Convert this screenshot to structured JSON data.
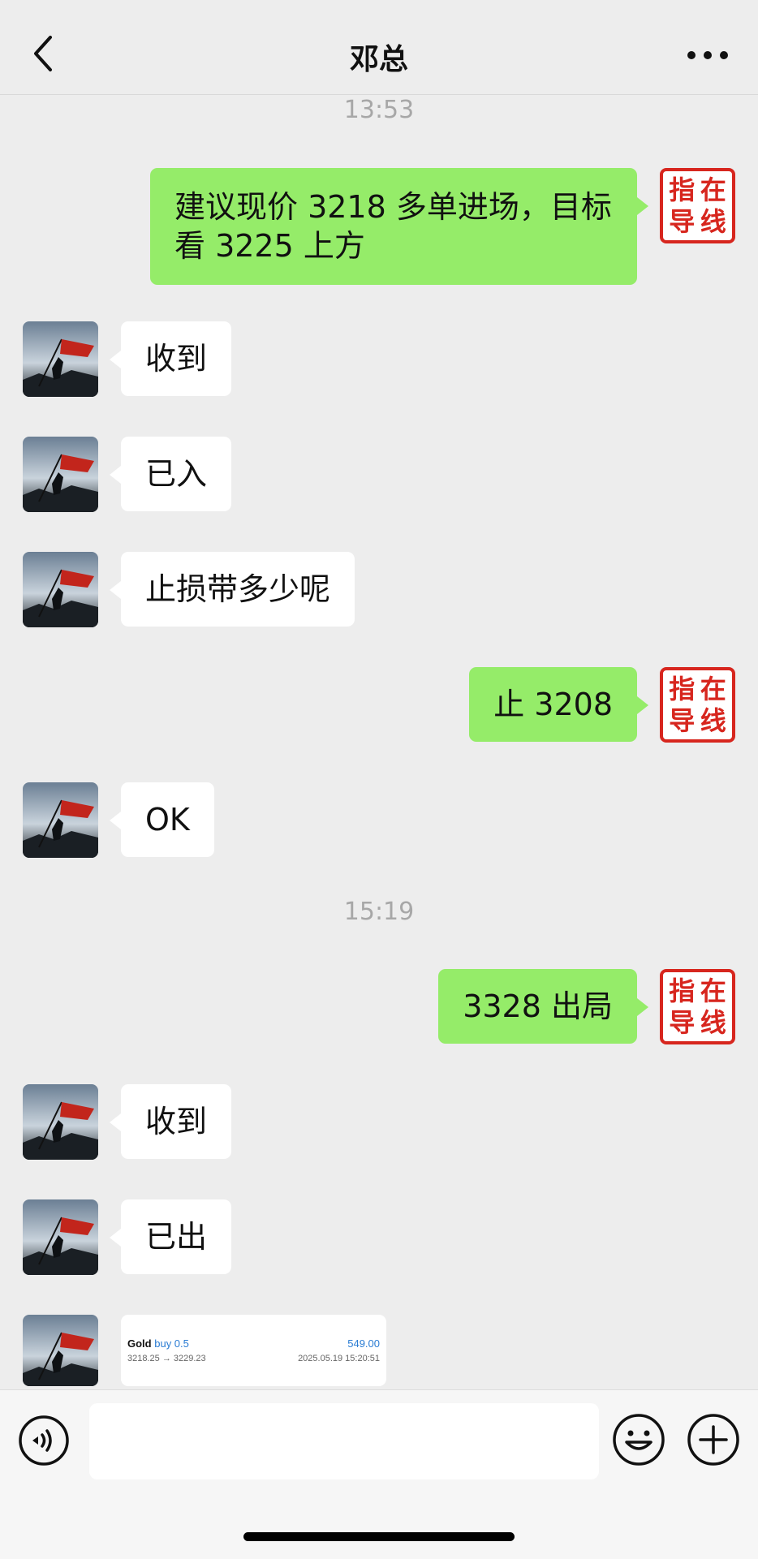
{
  "header": {
    "title": "邓总"
  },
  "times": [
    "13:53",
    "15:19"
  ],
  "messages": [
    {
      "from": "me",
      "text": "建议现价 3218 多单进场，目标看 3225 上方"
    },
    {
      "from": "other",
      "text": "收到"
    },
    {
      "from": "other",
      "text": "已入"
    },
    {
      "from": "other",
      "text": "止损带多少呢"
    },
    {
      "from": "me",
      "text": "止 3208"
    },
    {
      "from": "other",
      "text": "OK"
    },
    {
      "from": "me",
      "text": "3328 出局"
    },
    {
      "from": "other",
      "text": "收到"
    },
    {
      "from": "other",
      "text": "已出"
    }
  ],
  "seal_text": [
    "指",
    "在",
    "导",
    "线"
  ],
  "trade_card": {
    "symbol": "Gold",
    "direction": "buy 0.5",
    "profit": "549.00",
    "prices": "3218.25 → 3229.23",
    "datetime": "2025.05.19 15:20:51"
  },
  "icons": {
    "back": "chevron-left-icon",
    "more": "more-dots-icon",
    "voice": "voice-icon",
    "emoji": "emoji-icon",
    "plus": "plus-icon"
  },
  "colors": {
    "me_bubble": "#95ec69",
    "other_bubble": "#ffffff",
    "seal": "#d7261e",
    "profit": "#2a7cd3"
  }
}
